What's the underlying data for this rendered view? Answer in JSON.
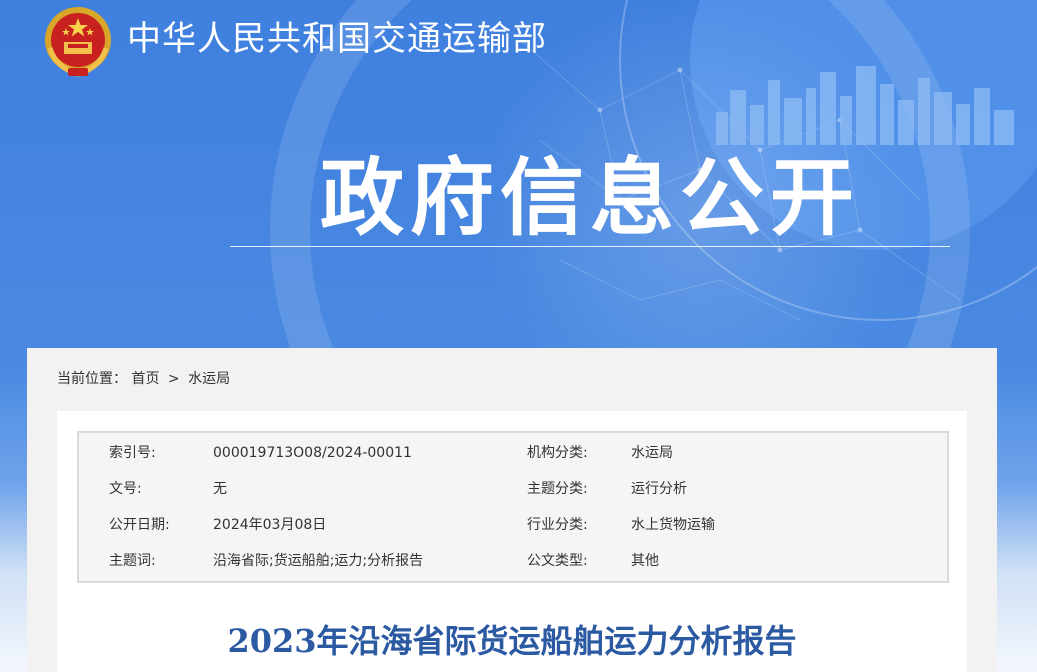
{
  "header": {
    "ministry_name": "中华人民共和国交通运输部",
    "emblem_icon": "national-emblem-icon"
  },
  "banner": {
    "title": "政府信息公开"
  },
  "breadcrumb": {
    "prefix": "当前位置：",
    "items": [
      {
        "label": "首页"
      },
      {
        "label": "水运局"
      }
    ],
    "separator": ">"
  },
  "meta": {
    "rows": [
      {
        "label1": "索引号:",
        "value1": "000019713O08/2024-00011",
        "label2": "机构分类:",
        "value2": "水运局"
      },
      {
        "label1": "文号:",
        "value1": "无",
        "label2": "主题分类:",
        "value2": "运行分析"
      },
      {
        "label1": "公开日期:",
        "value1": "2024年03月08日",
        "label2": "行业分类:",
        "value2": "水上货物运输"
      },
      {
        "label1": "主题词:",
        "value1": "沿海省际;货运船舶;运力;分析报告",
        "label2": "公文类型:",
        "value2": "其他"
      }
    ]
  },
  "document": {
    "title": "2023年沿海省际货运船舶运力分析报告"
  },
  "colors": {
    "banner_blue": "#4a8ae2",
    "title_blue": "#2b5aa3",
    "panel_gray": "#f2f2f2"
  }
}
